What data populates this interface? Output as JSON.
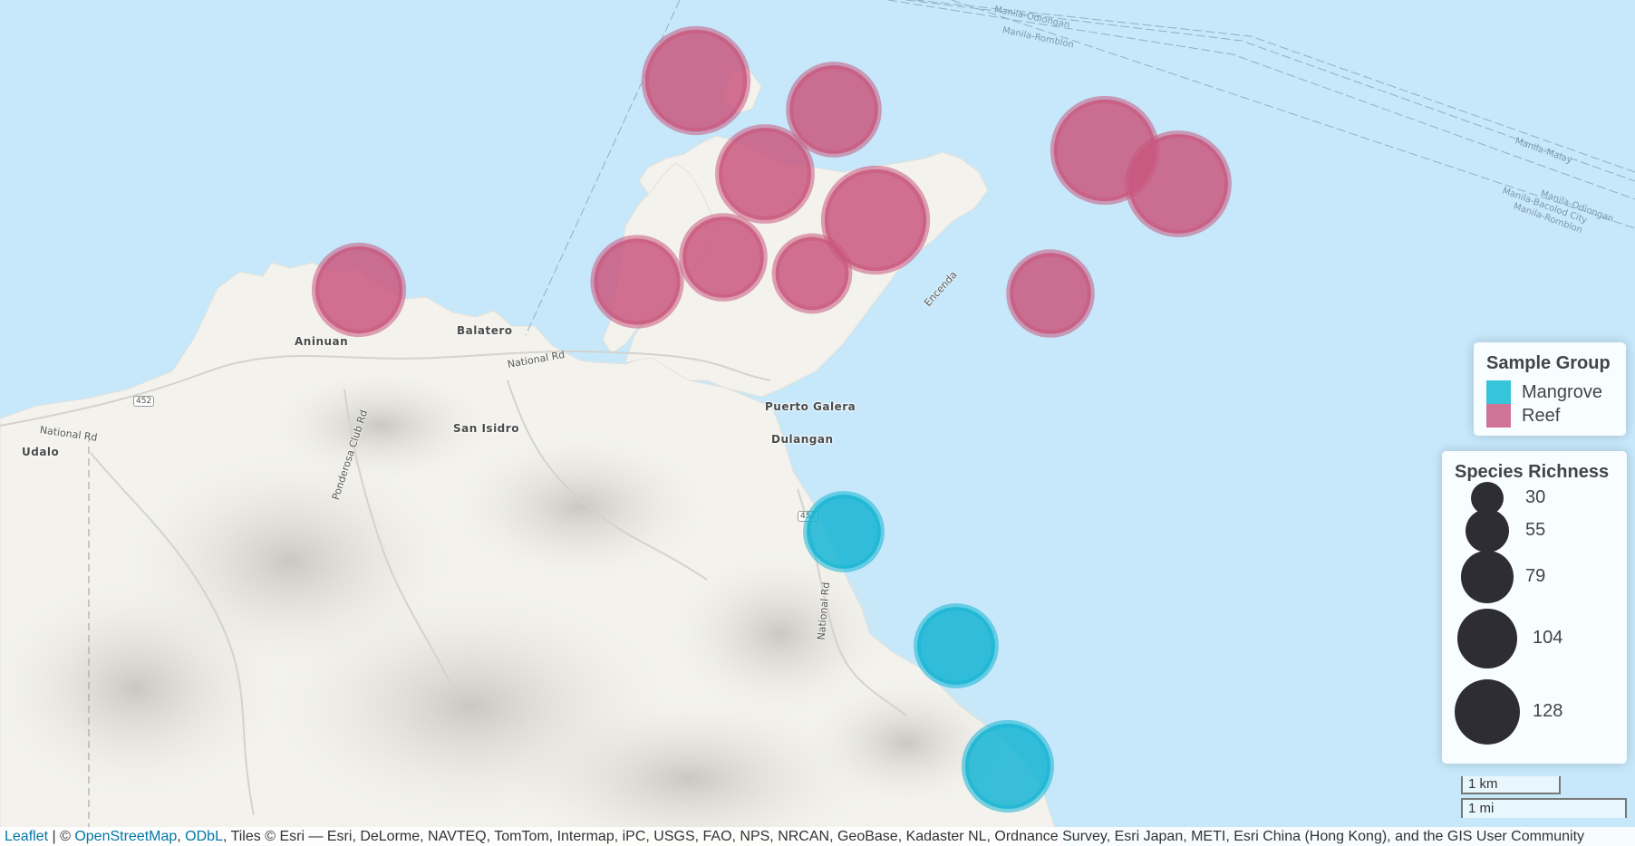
{
  "colors": {
    "mangrove": "#16b5d3",
    "reef": "#c9587e",
    "water": "#c6e8fa",
    "land": "#f4f3ee"
  },
  "places": [
    {
      "name": "Aninuan"
    },
    {
      "name": "Balatero"
    },
    {
      "name": "Puerto Galera"
    },
    {
      "name": "Dulangan"
    },
    {
      "name": "San Isidro"
    },
    {
      "name": "Udalo"
    }
  ],
  "roads": {
    "national_rd_1": "National Rd",
    "national_rd_2": "National Rd",
    "national_rd_3": "National Rd",
    "ponderosa": "Ponderosa Club Rd",
    "encenda": "Encenda",
    "shield_1": "452",
    "shield_2": "452"
  },
  "ferries": {
    "f1": "Manila-Odiongan",
    "f2": "Manila-Romblon",
    "f3": "Manila-Malay",
    "f4": "Manila-Odiongan",
    "f5": "Manila-Bacolod City",
    "f6": "Manila-Romblon"
  },
  "samples": [
    {
      "group": "Reef",
      "richness": 128
    },
    {
      "group": "Reef",
      "richness": 95
    },
    {
      "group": "Reef",
      "richness": 104
    },
    {
      "group": "Reef",
      "richness": 128
    },
    {
      "group": "Reef",
      "richness": 128
    },
    {
      "group": "Reef",
      "richness": 122
    },
    {
      "group": "Reef",
      "richness": 90
    },
    {
      "group": "Reef",
      "richness": 79
    },
    {
      "group": "Reef",
      "richness": 92
    },
    {
      "group": "Reef",
      "richness": 63
    },
    {
      "group": "Reef",
      "richness": 79
    },
    {
      "group": "Mangrove",
      "richness": 65
    },
    {
      "group": "Mangrove",
      "richness": 72
    },
    {
      "group": "Mangrove",
      "richness": 88
    }
  ],
  "legend_group": {
    "title": "Sample Group",
    "items": [
      {
        "label": "Mangrove",
        "color": "#36c4db"
      },
      {
        "label": "Reef",
        "color": "#cf7494"
      }
    ]
  },
  "legend_size": {
    "title": "Species Richness",
    "items": [
      {
        "label": "30",
        "value": 30
      },
      {
        "label": "55",
        "value": 55
      },
      {
        "label": "79",
        "value": 79
      },
      {
        "label": "104",
        "value": 104
      },
      {
        "label": "128",
        "value": 128
      }
    ]
  },
  "scale": {
    "km": "1 km",
    "mi": "1 mi"
  },
  "attribution": {
    "leaflet": "Leaflet",
    "sep": " | © ",
    "osm": "OpenStreetMap",
    "comma": ", ",
    "odbl": "ODbL",
    "rest": ", Tiles © Esri — Esri, DeLorme, NAVTEQ, TomTom, Intermap, iPC, USGS, FAO, NPS, NRCAN, GeoBase, Kadaster NL, Ordnance Survey, Esri Japan, METI, Esri China (Hong Kong), and the GIS User Community"
  }
}
